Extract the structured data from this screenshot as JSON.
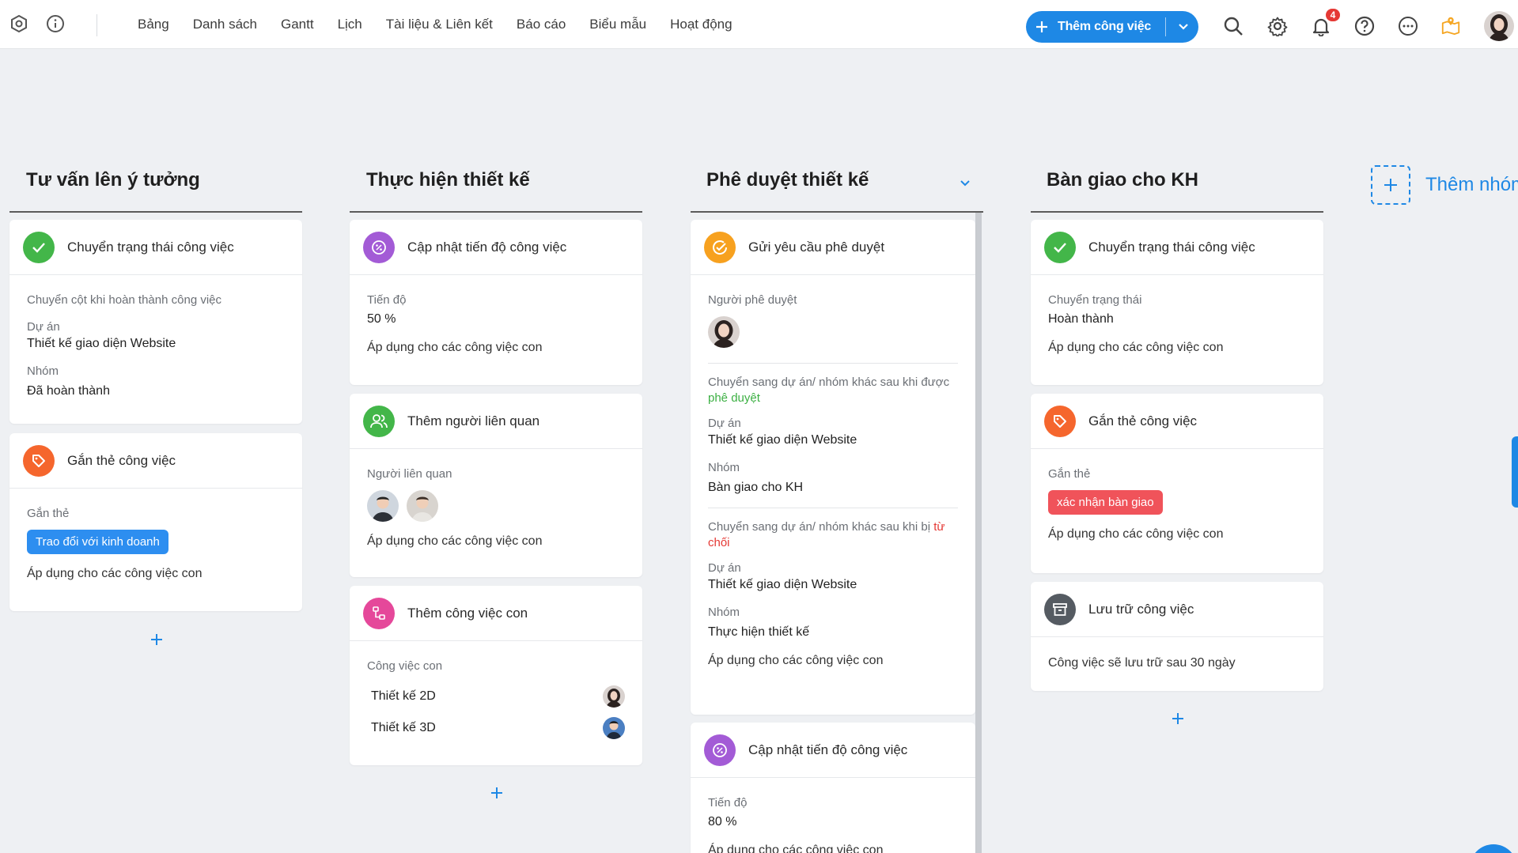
{
  "nav": [
    "Bảng",
    "Danh sách",
    "Gantt",
    "Lịch",
    "Tài liệu & Liên kết",
    "Báo cáo",
    "Biểu mẫu",
    "Hoạt động"
  ],
  "toolbar": {
    "add_task_label": "Thêm công việc",
    "notification_count": "4"
  },
  "columns": [
    {
      "title": "Tư vấn lên ý tưởng",
      "cards": [
        {
          "title": "Chuyển trạng thái công việc",
          "subtitle": "Chuyển cột khi hoàn thành công việc",
          "project_label": "Dự án",
          "project_value": "Thiết kế giao diện Website",
          "group_label": "Nhóm",
          "group_value": "Đã hoàn thành"
        },
        {
          "title": "Gắn thẻ công việc",
          "tag_label": "Gắn thẻ",
          "tag_value": "Trao đổi với kinh doanh",
          "apply": "Áp dụng cho các công việc con"
        }
      ]
    },
    {
      "title": "Thực hiện thiết kế",
      "cards": [
        {
          "title": "Cập nhật tiến độ công việc",
          "progress_label": "Tiến độ",
          "progress_value": "50 %",
          "apply": "Áp dụng cho các công việc con"
        },
        {
          "title": "Thêm người liên quan",
          "people_label": "Người liên quan",
          "apply": "Áp dụng cho các công việc con"
        },
        {
          "title": "Thêm công việc con",
          "subtasks_label": "Công việc con",
          "subtasks": [
            "Thiết kế 2D",
            "Thiết kế 3D"
          ]
        }
      ]
    },
    {
      "title": "Phê duyệt thiết kế",
      "cards": [
        {
          "title": "Gửi yêu cầu phê duyệt",
          "approver_label": "Người phê duyệt",
          "approved_text": "Chuyển sang dự án/ nhóm khác sau khi được",
          "approved_word": "phê duyệt",
          "approved_project_label": "Dự án",
          "approved_project_value": "Thiết kế giao diện Website",
          "approved_group_label": "Nhóm",
          "approved_group_value": "Bàn giao cho KH",
          "rejected_text": "Chuyển sang dự án/ nhóm khác sau khi bị",
          "rejected_word": "từ chối",
          "rejected_project_label": "Dự án",
          "rejected_project_value": "Thiết kế giao diện Website",
          "rejected_group_label": "Nhóm",
          "rejected_group_value": "Thực hiện thiết kế",
          "apply": "Áp dụng cho các công việc con"
        },
        {
          "title": "Cập nhật tiến độ công việc",
          "progress_label": "Tiến độ",
          "progress_value": "80 %",
          "apply": "Áp dụng cho các công việc con"
        }
      ]
    },
    {
      "title": "Bàn giao cho KH",
      "cards": [
        {
          "title": "Chuyển trạng thái công việc",
          "status_label": "Chuyển trạng thái",
          "status_value": "Hoàn thành",
          "apply": "Áp dụng cho các công việc con"
        },
        {
          "title": "Gắn thẻ công việc",
          "tag_label": "Gắn thẻ",
          "tag_value": "xác nhận bàn giao",
          "apply": "Áp dụng cho các công việc con"
        },
        {
          "title": "Lưu trữ công việc",
          "note": "Công việc sẽ lưu trữ sau 30 ngày"
        }
      ]
    }
  ],
  "add_group_label": "Thêm nhóm",
  "colors": {
    "accent": "#1e88e5",
    "green": "#43b649",
    "orange": "#f5662d",
    "purple": "#a35bd6",
    "pink": "#e5489a",
    "approve_orange": "#f7a11f",
    "tag_blue": "#2d8ef0",
    "tag_red": "#f0535a",
    "archive": "#555b62"
  }
}
